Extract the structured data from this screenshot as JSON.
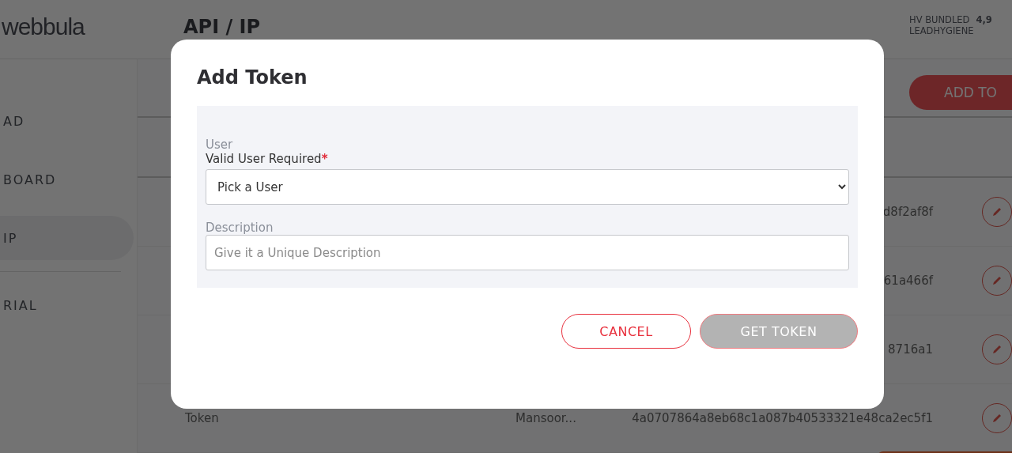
{
  "header": {
    "logo": "webbula",
    "title": "API / IP",
    "account_name": "HV BUNDLED",
    "account_value": "4,9",
    "account_sub": "LEADHYGIENE"
  },
  "sidebar": {
    "items": [
      {
        "label": "AD",
        "selected": false
      },
      {
        "label": "BOARD",
        "selected": false
      },
      {
        "label": "IP",
        "selected": true
      },
      {
        "label": "RIAL",
        "selected": false
      }
    ]
  },
  "add_button": "ADD TO",
  "table": {
    "rows": [
      {
        "name": "",
        "user": "",
        "token": "d8f2af8f"
      },
      {
        "name": "",
        "user": "",
        "token": "61a466f"
      },
      {
        "name": "",
        "user": "",
        "token": "8716a1"
      },
      {
        "name": "Token",
        "user": "Mansoor...",
        "token": "4a0707864a8eb68c1a087b40533321e48ca2ec5f1"
      }
    ]
  },
  "dialog": {
    "title": "Add Token",
    "user_field": {
      "label": "User",
      "hint": "Valid User Required",
      "required_mark": "*",
      "value": "Pick a User"
    },
    "description_field": {
      "label": "Description",
      "placeholder": "Give it a Unique Description"
    },
    "buttons": [
      {
        "label": "CANCEL",
        "kind": "secondary",
        "disabled": false
      },
      {
        "label": "GET TOKEN",
        "kind": "primary",
        "disabled": true
      }
    ]
  }
}
